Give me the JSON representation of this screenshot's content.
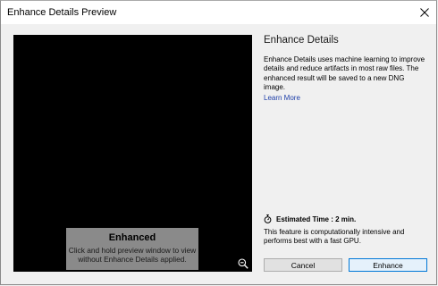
{
  "window": {
    "title": "Enhance Details Preview"
  },
  "preview": {
    "overlay_title": "Enhanced",
    "overlay_description": "Click and hold preview window to view without Enhance Details applied."
  },
  "panel": {
    "heading": "Enhance Details",
    "description": "Enhance Details uses machine learning to improve details and reduce artifacts in most raw files. The enhanced result will be saved to a new DNG image.",
    "learn_more": "Learn More",
    "estimated_time": "Estimated Time : 2 min.",
    "note": "This feature is computationally intensive and performs best with a fast GPU."
  },
  "buttons": {
    "cancel": "Cancel",
    "enhance": "Enhance"
  },
  "icons": {
    "close": "close-icon",
    "zoom": "zoom-out-icon",
    "timer": "stopwatch-icon"
  },
  "colors": {
    "link": "#1d3ea8",
    "primary_border": "#0078d7",
    "preview_bg": "#000000"
  }
}
